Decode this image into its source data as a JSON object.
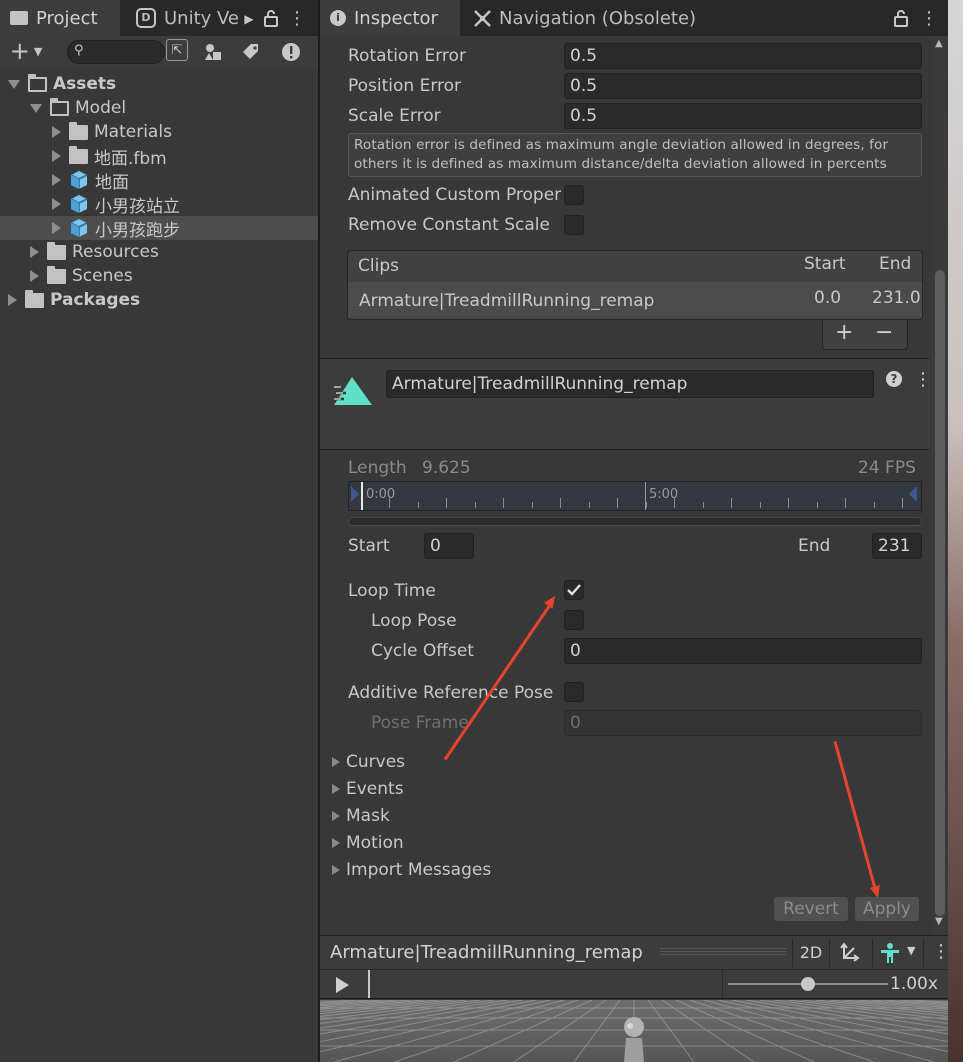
{
  "left_panel": {
    "tabs": [
      {
        "label": "Project",
        "icon": "folder-icon"
      },
      {
        "label": "Unity Ve",
        "icon": "unity-version-control-icon"
      }
    ],
    "toolbar": {
      "add_label": "+",
      "search_placeholder": ""
    },
    "tree": [
      {
        "label": "Assets",
        "indent": 0,
        "expanded": true,
        "kind": "folder-open",
        "bold": true
      },
      {
        "label": "Model",
        "indent": 1,
        "expanded": true,
        "kind": "folder-open"
      },
      {
        "label": "Materials",
        "indent": 2,
        "expanded": false,
        "kind": "folder"
      },
      {
        "label": "地面.fbm",
        "indent": 2,
        "expanded": false,
        "kind": "folder"
      },
      {
        "label": "地面",
        "indent": 2,
        "expanded": false,
        "kind": "model"
      },
      {
        "label": "小男孩站立",
        "indent": 2,
        "expanded": false,
        "kind": "model"
      },
      {
        "label": "小男孩跑步",
        "indent": 2,
        "expanded": false,
        "kind": "model",
        "selected": true
      },
      {
        "label": "Resources",
        "indent": 1,
        "expanded": false,
        "kind": "folder"
      },
      {
        "label": "Scenes",
        "indent": 1,
        "expanded": false,
        "kind": "folder"
      },
      {
        "label": "Packages",
        "indent": 0,
        "expanded": false,
        "kind": "folder",
        "bold": true
      }
    ]
  },
  "inspector": {
    "tabs": [
      {
        "label": "Inspector",
        "icon": "info-icon"
      },
      {
        "label": "Navigation (Obsolete)",
        "icon": "navigation-icon"
      }
    ],
    "compression": {
      "rotation_error_label": "Rotation Error",
      "rotation_error": "0.5",
      "position_error_label": "Position Error",
      "position_error": "0.5",
      "scale_error_label": "Scale Error",
      "scale_error": "0.5",
      "help_text": "Rotation error is defined as maximum angle deviation allowed in degrees, for others it is defined as maximum distance/delta deviation allowed in percents",
      "animated_custom_label": "Animated Custom Proper",
      "remove_constant_scale_label": "Remove Constant Scale"
    },
    "clips": {
      "header": "Clips",
      "start_header": "Start",
      "end_header": "End",
      "rows": [
        {
          "name": "Armature|TreadmillRunning_remap",
          "start": "0.0",
          "end": "231.0"
        }
      ],
      "add_label": "+",
      "remove_label": "−"
    },
    "clip": {
      "name": "Armature|TreadmillRunning_remap",
      "length_label": "Length",
      "length": "9.625",
      "fps": "24 FPS",
      "timeline_start": "0:00",
      "timeline_mid": "5:00",
      "start_label": "Start",
      "start": "0",
      "end_label": "End",
      "end": "231",
      "loop_time_label": "Loop Time",
      "loop_time": true,
      "loop_pose_label": "Loop Pose",
      "loop_pose": false,
      "cycle_offset_label": "Cycle Offset",
      "cycle_offset": "0",
      "additive_label": "Additive Reference Pose",
      "additive": false,
      "pose_frame_label": "Pose Frame",
      "pose_frame": "0"
    },
    "foldouts": [
      "Curves",
      "Events",
      "Mask",
      "Motion",
      "Import Messages"
    ],
    "revert_label": "Revert",
    "apply_label": "Apply"
  },
  "preview": {
    "title": "Armature|TreadmillRunning_remap",
    "mode_2d": "2D",
    "speed": "1.00x",
    "speed_level": 0.5
  },
  "colors": {
    "annotation_arrow": "#e8432d",
    "clip_icon": "#5fe0c8",
    "accent_check": "#e0e0e0"
  }
}
